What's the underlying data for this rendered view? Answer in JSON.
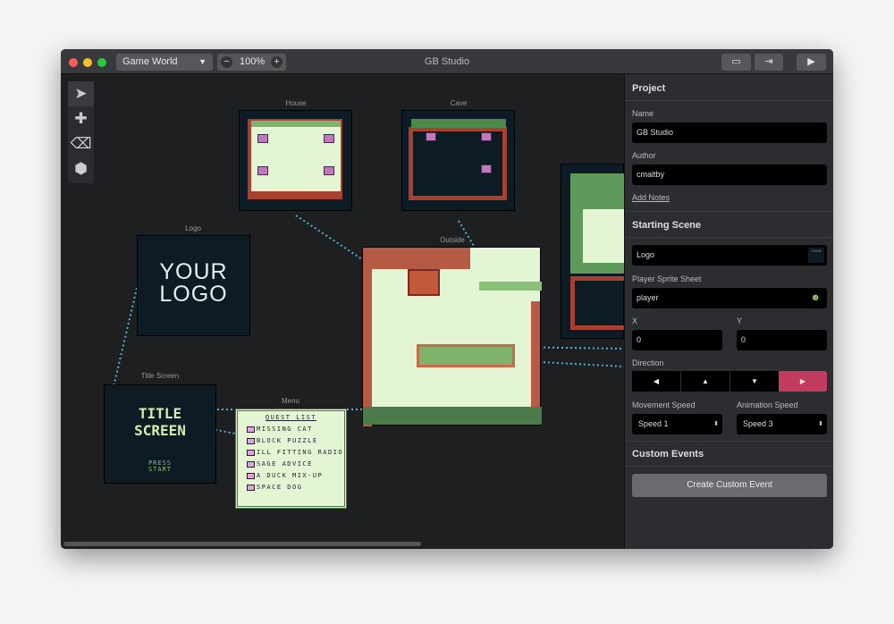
{
  "window": {
    "title": "GB Studio",
    "world_select": "Game World",
    "zoom": "100%"
  },
  "toolbar": {
    "open_icon": "folder-icon",
    "export_icon": "export-icon",
    "play_icon": "play-icon"
  },
  "tools": [
    {
      "icon": "select-arrow-icon"
    },
    {
      "icon": "add-plus-icon"
    },
    {
      "icon": "eraser-icon"
    },
    {
      "icon": "cube-icon"
    }
  ],
  "scenes": {
    "house": "House",
    "cave": "Cave",
    "logo": "Logo",
    "outside": "Outside",
    "title_screen": "Title Screen",
    "menu": "Menu"
  },
  "logo_scene": {
    "line1": "YOUR",
    "line2": "LOGO"
  },
  "title_scene": {
    "line1": "TITLE",
    "line2": "SCREEN",
    "press": "PRESS",
    "start": "START"
  },
  "menu_scene": {
    "header": "QUEST LIST",
    "items": [
      "MISSING CAT",
      "BLOCK PUZZLE",
      "ILL FITTING RADIO",
      "SAGE ADVICE",
      "A DUCK MIX-UP",
      "SPACE DOG"
    ]
  },
  "sidebar": {
    "project_heading": "Project",
    "name_label": "Name",
    "name_value": "GB Studio",
    "author_label": "Author",
    "author_value": "cmaltby",
    "add_notes": "Add Notes",
    "starting_heading": "Starting Scene",
    "starting_scene": "Logo",
    "sprite_label": "Player Sprite Sheet",
    "sprite_value": "player",
    "x_label": "X",
    "x_value": "0",
    "y_label": "Y",
    "y_value": "0",
    "direction_label": "Direction",
    "directions": [
      "◀",
      "▲",
      "▼",
      "▶"
    ],
    "selected_direction": "right",
    "move_speed_label": "Movement Speed",
    "move_speed": "Speed 1",
    "anim_speed_label": "Animation Speed",
    "anim_speed": "Speed 3",
    "custom_heading": "Custom Events",
    "create_button": "Create Custom Event"
  },
  "colors": {
    "accent": "#c23c5f",
    "connection": "#4fb3d6",
    "gb_light": "#e3f5d2"
  }
}
